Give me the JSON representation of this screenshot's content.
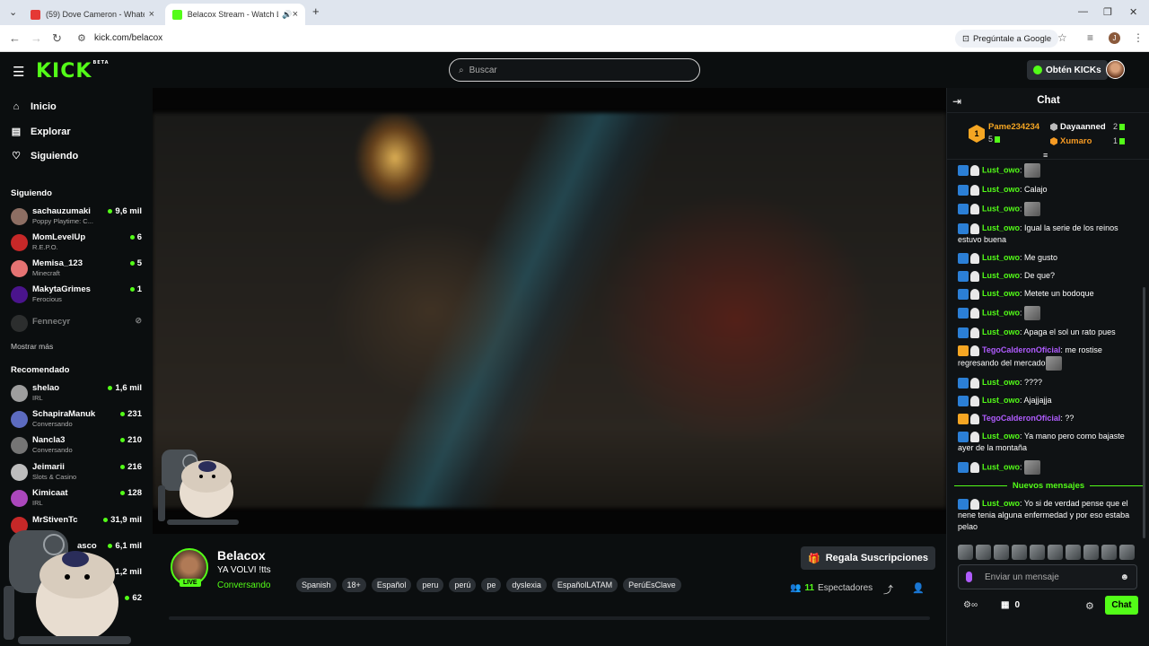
{
  "browser": {
    "tabs": [
      {
        "title": "(59) Dove Cameron - Whatever",
        "color": "#e53935"
      },
      {
        "title": "Belacox Stream - Watch Live",
        "color": "#53fc18"
      }
    ],
    "url": "kick.com/belacox",
    "ask_google": "Pregúntale a Google",
    "profile_initial": "J"
  },
  "topbar": {
    "logo": "KICK",
    "logo_beta": "BETA",
    "search_placeholder": "Buscar",
    "kicks_button": "Obtén KICKs"
  },
  "sidebar": {
    "nav": [
      {
        "label": "Inicio",
        "icon": "home-icon",
        "glyph": "⌂"
      },
      {
        "label": "Explorar",
        "icon": "browse-icon",
        "glyph": "▤"
      },
      {
        "label": "Siguiendo",
        "icon": "heart-icon",
        "glyph": "♡"
      }
    ],
    "following_title": "Siguiendo",
    "following": [
      {
        "name": "sachauzumaki",
        "category": "Poppy Playtime: C...",
        "viewers": "9,6 mil",
        "color": "#8d6e63"
      },
      {
        "name": "MomLevelUp",
        "category": "R.E.P.O.",
        "viewers": "6",
        "color": "#c62828"
      },
      {
        "name": "Memisa_123",
        "category": "Minecraft",
        "viewers": "5",
        "color": "#e57373"
      },
      {
        "name": "MakytaGrimes",
        "category": "Ferocious",
        "viewers": "1",
        "color": "#4a148c"
      },
      {
        "name": "Fennecyr",
        "category": "",
        "viewers": "",
        "color": "#555"
      }
    ],
    "show_more": "Mostrar más",
    "recommended_title": "Recomendado",
    "recommended": [
      {
        "name": "shelao",
        "category": "IRL",
        "viewers": "1,6 mil",
        "color": "#9e9e9e"
      },
      {
        "name": "SchapiraManuk",
        "category": "Conversando",
        "viewers": "231",
        "color": "#5c6bc0"
      },
      {
        "name": "Nancla3",
        "category": "Conversando",
        "viewers": "210",
        "color": "#757575"
      },
      {
        "name": "Jeimarii",
        "category": "Slots & Casino",
        "viewers": "216",
        "color": "#bdbdbd"
      },
      {
        "name": "Kimicaat",
        "category": "IRL",
        "viewers": "128",
        "color": "#ab47bc"
      },
      {
        "name": "MrStivenTc",
        "category": "",
        "viewers": "31,9 mil",
        "color": "#c62828"
      },
      {
        "name": "asco",
        "category": "",
        "viewers": "6,1 mil",
        "color": "#8d6e63"
      },
      {
        "name": "",
        "category": "",
        "viewers": "1,2 mil",
        "color": "#555"
      },
      {
        "name": "",
        "category": "",
        "viewers": "62",
        "color": "#555"
      }
    ]
  },
  "stream": {
    "channel": "Belacox",
    "live_badge": "LIVE",
    "title": "YA VOLVI !tts",
    "category": "Conversando",
    "tags": [
      "Spanish",
      "18+",
      "Español",
      "peru",
      "perú",
      "pe",
      "dyslexia",
      "EspañolLATAM",
      "PerúEsClave"
    ],
    "subscribe_button": "Regala Suscripciones",
    "viewers": "11",
    "viewers_label": "Espectadores"
  },
  "chat": {
    "title": "Chat",
    "leaderboard": {
      "first": {
        "rank": "1",
        "name": "Pame234234",
        "count": "5"
      },
      "second": {
        "name": "Dayaanned",
        "count": "2"
      },
      "third": {
        "name": "Xumaro",
        "count": "1"
      }
    },
    "messages": [
      {
        "user": "Lust_owo",
        "text": "",
        "emote": true,
        "badge": "b1",
        "purple": false
      },
      {
        "user": "Lust_owo",
        "text": "Calajo",
        "emote": false,
        "badge": "b1",
        "purple": false
      },
      {
        "user": "Lust_owo",
        "text": "",
        "emote": true,
        "badge": "b1",
        "purple": false
      },
      {
        "user": "Lust_owo",
        "text": "Igual la serie de los reinos estuvo buena",
        "emote": false,
        "badge": "b1",
        "purple": false
      },
      {
        "user": "Lust_owo",
        "text": "Me gusto",
        "emote": false,
        "badge": "b1",
        "purple": false
      },
      {
        "user": "Lust_owo",
        "text": "De que?",
        "emote": false,
        "badge": "b1",
        "purple": false
      },
      {
        "user": "Lust_owo",
        "text": "Metete un bodoque",
        "emote": false,
        "badge": "b1",
        "purple": false
      },
      {
        "user": "Lust_owo",
        "text": "",
        "emote": true,
        "badge": "b1",
        "purple": false
      },
      {
        "user": "Lust_owo",
        "text": "Apaga el sol un rato pues",
        "emote": false,
        "badge": "b1",
        "purple": false
      },
      {
        "user": "TegoCalderonOficial",
        "text": "me rostise regresando del mercado",
        "emote": true,
        "badge": "b3",
        "purple": true
      },
      {
        "user": "Lust_owo",
        "text": "????",
        "emote": false,
        "badge": "b1",
        "purple": false
      },
      {
        "user": "Lust_owo",
        "text": "Ajajjajja",
        "emote": false,
        "badge": "b1",
        "purple": false
      },
      {
        "user": "TegoCalderonOficial",
        "text": "??",
        "emote": false,
        "badge": "b3",
        "purple": true
      },
      {
        "user": "Lust_owo",
        "text": "Ya mano pero como bajaste ayer de la montaña",
        "emote": false,
        "badge": "b1",
        "purple": false
      },
      {
        "user": "Lust_owo",
        "text": "",
        "emote": true,
        "badge": "b1",
        "purple": false
      }
    ],
    "new_messages_label": "Nuevos mensajes",
    "new_messages": [
      {
        "user": "Lust_owo",
        "text": "Yo si de verdad pense que el nene tenia alguna enfermedad y por eso estaba pelao",
        "emote": false,
        "badge": "b1",
        "purple": false
      }
    ],
    "input_placeholder": "Enviar un mensaje",
    "points": "0",
    "send_button": "Chat"
  }
}
